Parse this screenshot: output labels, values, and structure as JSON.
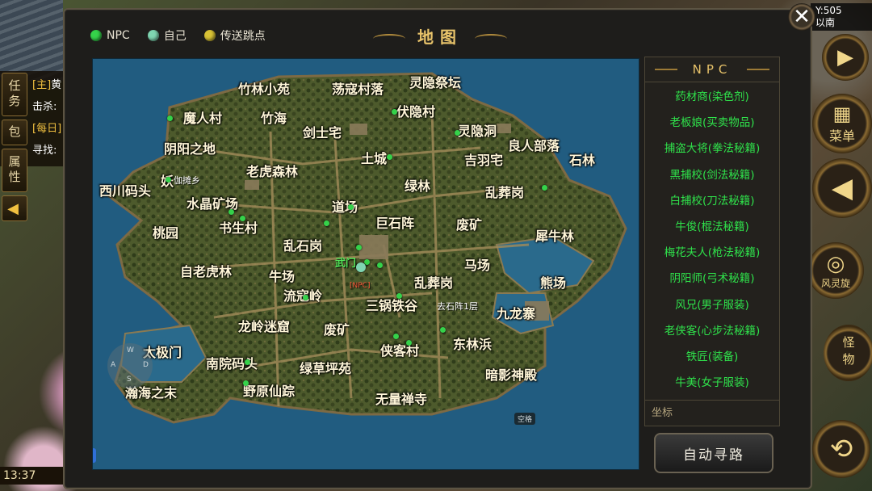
{
  "colors": {
    "npc": "#35d24a",
    "self": "#7fd6b2",
    "teleport": "#d8c235",
    "npc_text": "#2fe24b",
    "title": "#e8c36a",
    "sea": "#215c80"
  },
  "background": {
    "left_tabs": [
      "任务",
      "包",
      "属性"
    ],
    "left_arrow_icon": "triangle-left-icon",
    "quest_lines": [
      {
        "tag": "[主]",
        "text": "黄"
      },
      {
        "tag": "击杀:",
        "text": ""
      },
      {
        "tag": "[每日]",
        "text": ""
      },
      {
        "tag": "寻找:",
        "text": ""
      }
    ],
    "clock": "13:37",
    "coord_readout": {
      "y_line": "Y:505",
      "place_line": "以南"
    },
    "right_buttons": {
      "menu_label": "菜单",
      "whirlwind_label": "风灵旋",
      "monster_label": "怪物"
    }
  },
  "dialog": {
    "title": "地图",
    "close_icon": "close-icon",
    "legend": [
      {
        "label": "NPC",
        "color": "#35d24a"
      },
      {
        "label": "自己",
        "color": "#7fd6b2"
      },
      {
        "label": "传送跳点",
        "color": "#d8c235"
      }
    ],
    "map": {
      "places": [
        "竹林小苑",
        "荡寇村落",
        "灵隐祭坛",
        "魔人村",
        "竹海",
        "伏隐村",
        "剑士宅",
        "灵隐洞",
        "良人部落",
        "阴阳之地",
        "土城",
        "吉羽宅",
        "石林",
        "老虎森林",
        "西川码头",
        "妖",
        "绿林",
        "乱葬岗",
        "水晶矿场",
        "道场",
        "巨石阵",
        "废矿",
        "桃园",
        "书生村",
        "犀牛林",
        "乱石岗",
        "自老虎林",
        "牛场",
        "马场",
        "熊场",
        "乱葬岗",
        "流寇岭",
        "三锅铁谷",
        "九龙寨",
        "龙岭迷窟",
        "废矿",
        "东林浜",
        "太极门",
        "南院码头",
        "侠客村",
        "绿草坪苑",
        "暗影神殿",
        "瀚海之末",
        "野原仙踪",
        "无量禅寺"
      ],
      "small_labels": [
        "伽摊乡",
        "去石阵1层"
      ],
      "red_label": "[NPC]",
      "green_label": "武门",
      "compass_letters": [
        "A",
        "W",
        "D",
        "S"
      ],
      "space_tag": "空格"
    },
    "npc_panel": {
      "header": "NPC",
      "items": [
        "药材商(染色剂)",
        "老板娘(买卖物品)",
        "捕盗大将(拳法秘籍)",
        "黑捕校(剑法秘籍)",
        "白捕校(刀法秘籍)",
        "牛俊(棍法秘籍)",
        "梅花夫人(枪法秘籍)",
        "阴阳师(弓术秘籍)",
        "风兄(男子服装)",
        "老侠客(心步法秘籍)",
        "铁匠(装备)",
        "牛美(女子服装)"
      ],
      "footer_label": "坐标"
    },
    "auto_path_button": "自动寻路"
  }
}
